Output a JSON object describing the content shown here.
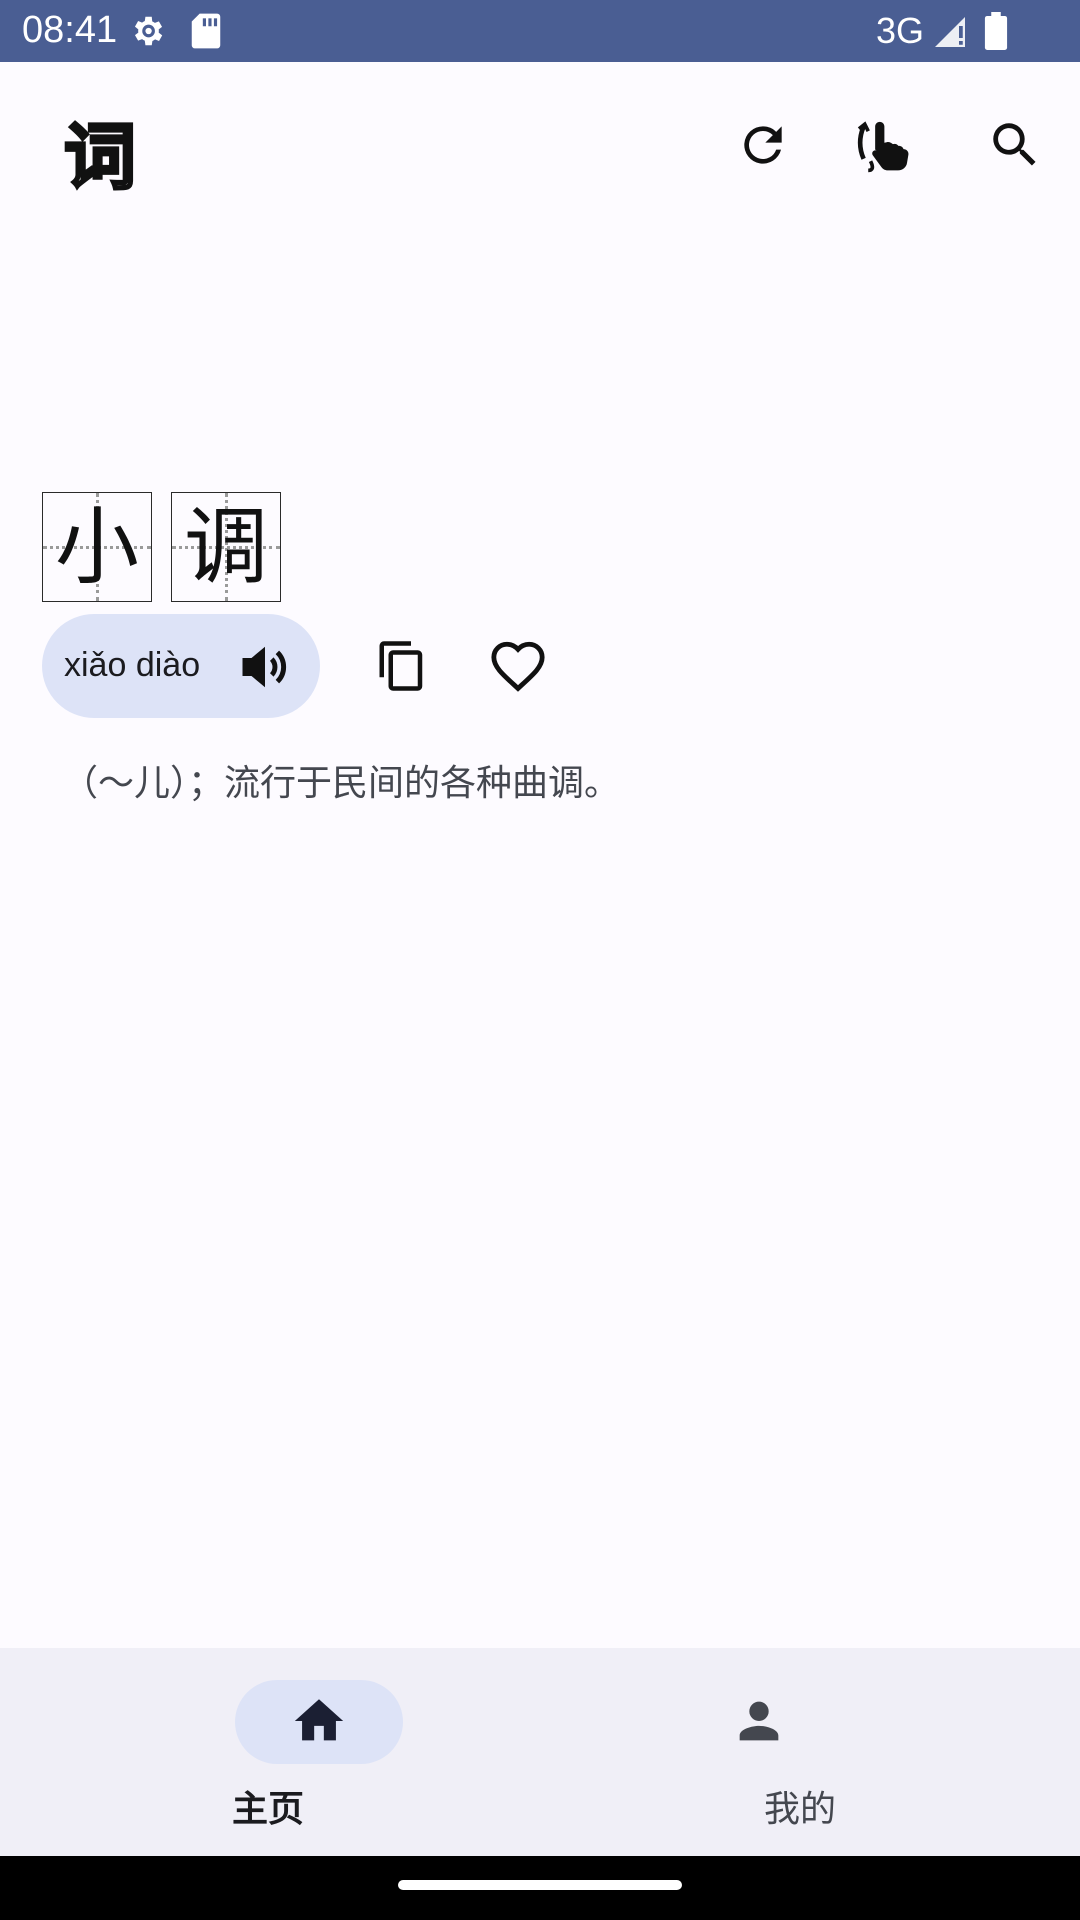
{
  "status_bar": {
    "time": "08:41",
    "network": "3G",
    "icons": [
      "settings-gear-icon",
      "sd-card-icon",
      "signal-icon",
      "battery-icon"
    ]
  },
  "app_bar": {
    "logo_char": "词",
    "actions": [
      "refresh-icon",
      "swipe-gesture-icon",
      "search-icon"
    ]
  },
  "word": {
    "characters": [
      "小",
      "调"
    ],
    "pinyin": "xiǎo diào",
    "definition": "（～儿）；流行于民间的各种曲调。"
  },
  "bottom_nav": {
    "items": [
      {
        "label": "主页",
        "icon": "home-icon",
        "active": true
      },
      {
        "label": "我的",
        "icon": "person-icon",
        "active": false
      }
    ]
  },
  "colors": {
    "status_bar": "#4a5e93",
    "background": "#fdfbff",
    "chip": "#dde3f7",
    "nav_bar": "#f0eff7"
  }
}
